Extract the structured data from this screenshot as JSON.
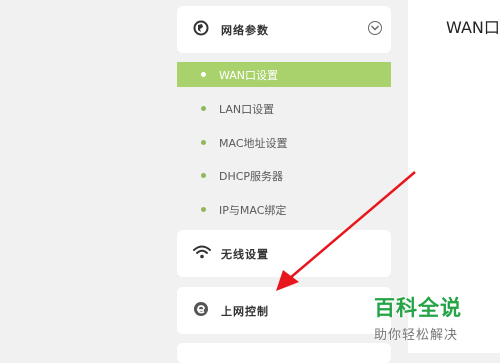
{
  "main": {
    "title": "WAN口"
  },
  "sidebar": {
    "network": {
      "label": "网络参数"
    },
    "sub_items": [
      {
        "label": "WAN口设置",
        "active": true
      },
      {
        "label": "LAN口设置",
        "active": false
      },
      {
        "label": "MAC地址设置",
        "active": false
      },
      {
        "label": "DHCP服务器",
        "active": false
      },
      {
        "label": "IP与MAC绑定",
        "active": false
      }
    ],
    "wireless": {
      "label": "无线设置"
    },
    "internet": {
      "label": "上网控制"
    }
  },
  "watermark": {
    "main": "百科全说",
    "sub": "助你轻松解决"
  },
  "colors": {
    "active": "#a9d26c",
    "dot": "#8fb85c",
    "arrow": "#e8161c",
    "brand": "#25a446"
  }
}
